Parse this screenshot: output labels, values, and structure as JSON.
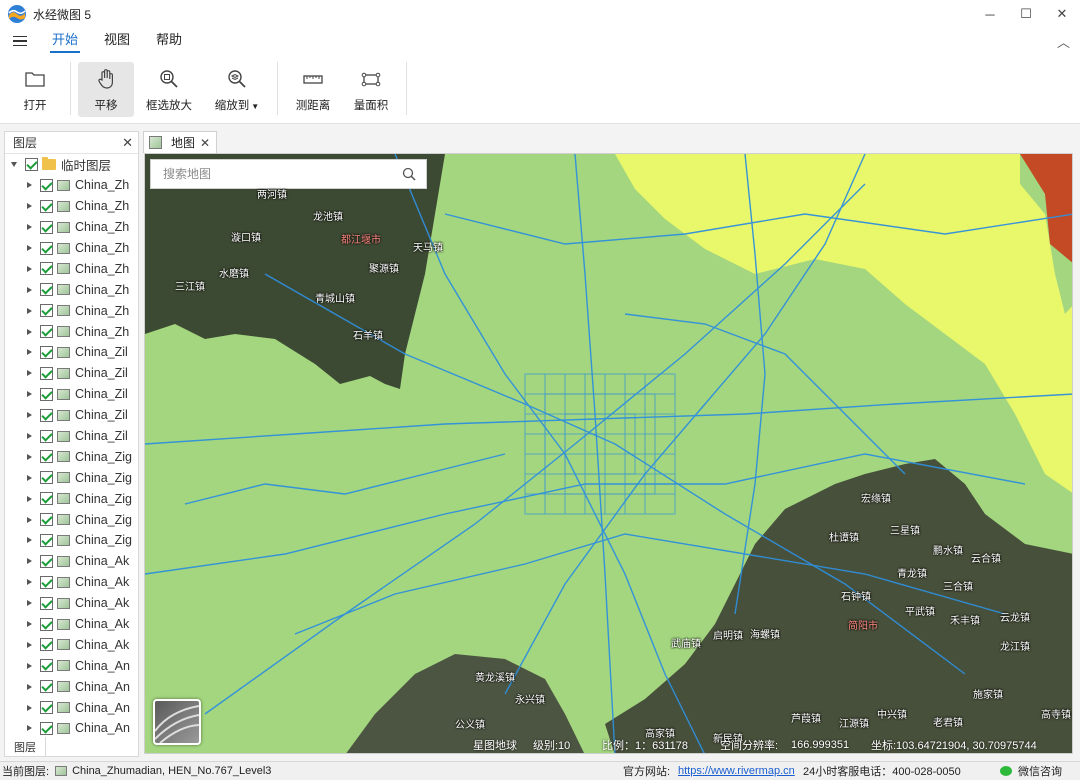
{
  "window": {
    "title": "水经微图 5",
    "minimize_icon": "minimize-icon",
    "maximize_icon": "maximize-icon",
    "close_icon": "close-icon"
  },
  "menu": {
    "tabs": [
      "开始",
      "视图",
      "帮助"
    ],
    "active": "开始"
  },
  "ribbon": {
    "open": "打开",
    "pan": "平移",
    "box_zoom": "框选放大",
    "zoom_to": "缩放到",
    "measure_distance": "测距离",
    "measure_area": "量面积"
  },
  "layer_panel": {
    "title": "图层",
    "root": "临时图层",
    "items": [
      "China_Zh",
      "China_Zh",
      "China_Zh",
      "China_Zh",
      "China_Zh",
      "China_Zh",
      "China_Zh",
      "China_Zh",
      "China_Zil",
      "China_Zil",
      "China_Zil",
      "China_Zil",
      "China_Zil",
      "China_Zig",
      "China_Zig",
      "China_Zig",
      "China_Zig",
      "China_Zig",
      "China_Ak",
      "China_Ak",
      "China_Ak",
      "China_Ak",
      "China_Ak",
      "China_An",
      "China_An",
      "China_An",
      "China_An"
    ],
    "bottom_tab": "图层"
  },
  "map": {
    "tab_label": "地图",
    "search_placeholder": "搜索地图",
    "labels": {
      "l1": "两河镇",
      "l2": "龙池镇",
      "l3": "漩口镇",
      "l4": "都江堰市",
      "l5": "天马镇",
      "l6": "聚源镇",
      "l7": "水磨镇",
      "l8": "三江镇",
      "l9": "青城山镇",
      "l10": "石羊镇",
      "l11": "宏缘镇",
      "l12": "三星镇",
      "l13": "杜谭镇",
      "l14": "鹏水镇",
      "l15": "青龙镇",
      "l16": "云合镇",
      "l17": "石钟镇",
      "l18": "三合镇",
      "l19": "平武镇",
      "l20": "禾丰镇",
      "l21": "云龙镇",
      "l22": "简阳市",
      "l23": "武庙镇",
      "l24": "启明镇",
      "l25": "海螺镇",
      "l26": "龙江镇",
      "l27": "施家镇",
      "l28": "芦葭镇",
      "l29": "江源镇",
      "l30": "老君镇",
      "l31": "高寺镇",
      "l32": "黄龙溪镇",
      "l33": "永兴镇",
      "l34": "公义镇",
      "l35": "高家镇",
      "l36": "中兴镇",
      "l37": "新民镇"
    },
    "status": {
      "basemap": "星图地球",
      "level": "级别:10",
      "scale": "比例：1：631178",
      "resolution_label": "空间分辨率:",
      "resolution": "166.999351",
      "coords": "坐标:103.64721904, 30.70975744"
    },
    "colors": {
      "green": "#a3d67f",
      "yellow": "#e9f76a",
      "roads": "#2f8fdc",
      "red": "#c44a26",
      "sat": "#3d4a33"
    }
  },
  "statusbar": {
    "current_layer_label": "当前图层:",
    "current_layer": "China_Zhumadian, HEN_No.767_Level3",
    "site_label": "官方网站:",
    "site_url": "https://www.rivermap.cn",
    "hotline": "24小时客服电话：400-028-0050",
    "wechat": "微信咨询"
  }
}
